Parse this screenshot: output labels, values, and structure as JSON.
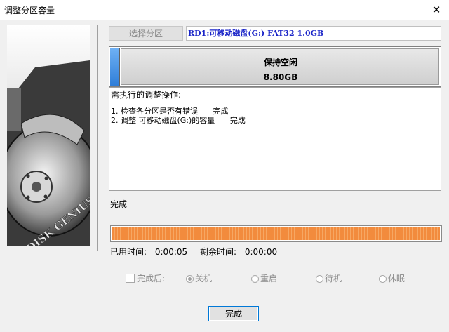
{
  "window": {
    "title": "调整分区容量"
  },
  "left_panel": {
    "logo_text": "DISK GENIUS"
  },
  "select_partition": {
    "label": "选择分区",
    "disk_info": "RD1:可移动磁盘(G:) FAT32 1.0GB"
  },
  "partition_bar": {
    "free_label": "保持空闲",
    "free_size": "8.80GB"
  },
  "operations": {
    "header": "需执行的调整操作:",
    "items": [
      {
        "num": "1.",
        "text": "检查各分区是否有错误",
        "status": "完成"
      },
      {
        "num": "2.",
        "text": "调整 可移动磁盘(G:)的容量",
        "status": "完成"
      }
    ]
  },
  "status_text": "完成",
  "progress": {
    "percent": 100
  },
  "times": {
    "elapsed_label": "已用时间:",
    "elapsed": "0:00:05",
    "remaining_label": "剩余时间:",
    "remaining": "0:00:00"
  },
  "after_complete": {
    "label": "完成后:",
    "options": [
      "关机",
      "重启",
      "待机",
      "休眠"
    ],
    "selected": "关机"
  },
  "buttons": {
    "done": "完成"
  }
}
